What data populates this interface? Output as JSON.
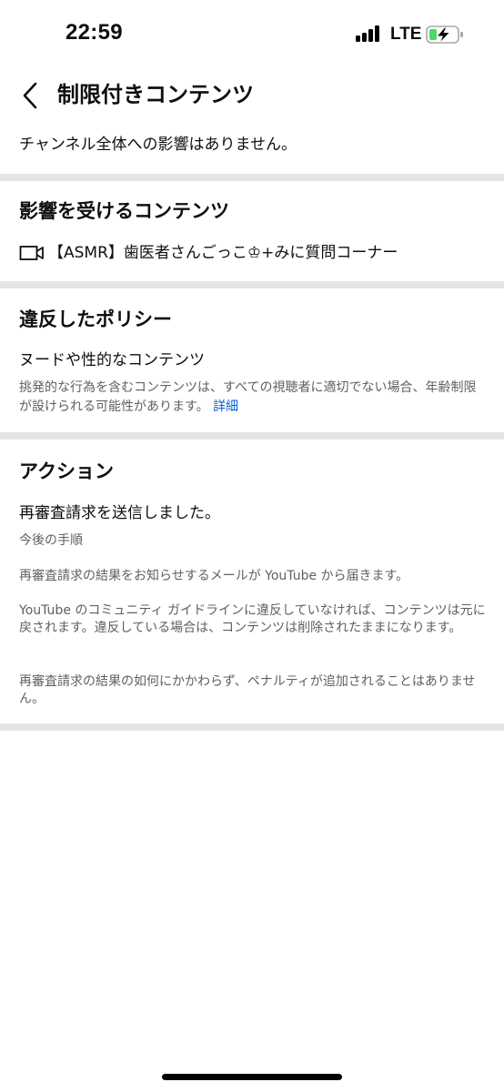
{
  "status_bar": {
    "time": "22:59",
    "network": "LTE",
    "signal_bars": 4,
    "battery_charging": true,
    "battery_color": "#4cd964"
  },
  "header": {
    "back_icon": "chevron-left-icon",
    "title": "制限付きコンテンツ"
  },
  "notice": "チャンネル全体への影響はありません。",
  "affected_section": {
    "title": "影響を受けるコンテンツ",
    "video_icon": "video-camera-icon",
    "video_title": "【ASMR】歯医者さんごっこ♔+みに質問コーナー"
  },
  "policy_section": {
    "title": "違反したポリシー",
    "policy_name": "ヌードや性的なコンテンツ",
    "description": "挑発的な行為を含むコンテンツは、すべての視聴者に適切でない場合、年齢制限が設けられる可能性があります。",
    "link_label": "詳細",
    "link_color": "#065fd4"
  },
  "action_section": {
    "title": "アクション",
    "status": "再審査請求を送信しました。",
    "next_steps_label": "今後の手順",
    "step_1": "再審査請求の結果をお知らせするメールが YouTube から届きます。",
    "step_2": "YouTube のコミュニティ ガイドラインに違反していなければ、コンテンツは元に戻されます。違反している場合は、コンテンツは削除されたままになります。",
    "step_3": "再審査請求の結果の如何にかかわらず、ペナルティが追加されることはありません。"
  }
}
